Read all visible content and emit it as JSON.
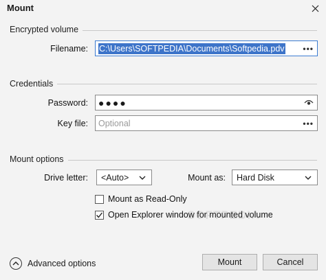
{
  "window": {
    "title": "Mount"
  },
  "sections": {
    "encrypted": "Encrypted volume",
    "credentials": "Credentials",
    "mount_options": "Mount options"
  },
  "filename": {
    "label": "Filename:",
    "value": "C:\\Users\\SOFTPEDIA\\Documents\\Softpedia.pdv",
    "browse": "•••"
  },
  "password": {
    "label": "Password:",
    "value": "●●●●",
    "reveal_icon": "eye-icon"
  },
  "keyfile": {
    "label": "Key file:",
    "placeholder": "Optional",
    "browse": "•••"
  },
  "drive_letter": {
    "label": "Drive letter:",
    "selected": "<Auto>"
  },
  "mount_as": {
    "label": "Mount as:",
    "selected": "Hard Disk"
  },
  "checkboxes": {
    "read_only": {
      "label": "Mount as Read-Only",
      "checked": false
    },
    "open_explorer": {
      "label": "Open Explorer window for mounted volume",
      "checked": true
    }
  },
  "advanced": {
    "label": "Advanced options"
  },
  "buttons": {
    "mount": "Mount",
    "cancel": "Cancel"
  },
  "watermark": "SOFTPEDIA"
}
